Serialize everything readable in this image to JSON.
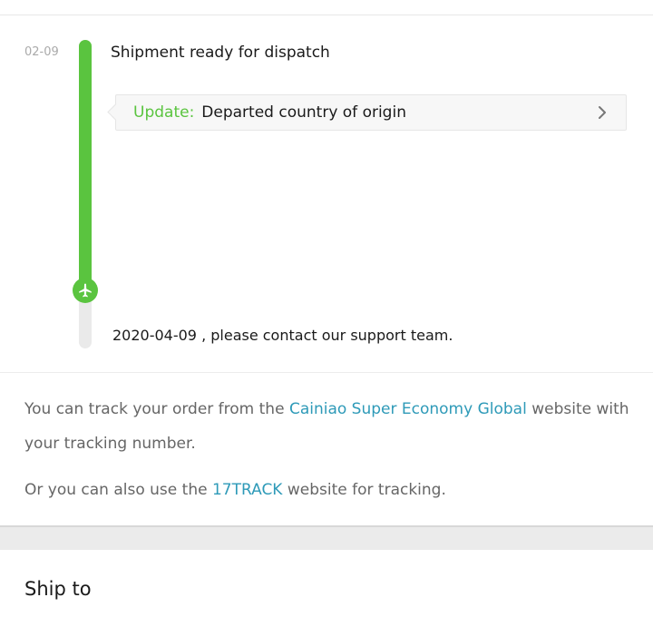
{
  "timeline": {
    "date": "02-09",
    "event_title": "Shipment ready for dispatch",
    "update_label": "Update:",
    "update_text": "Departed country of origin",
    "note": "2020-04-09 , please contact our support team."
  },
  "info": {
    "para1_prefix": "You can track your order from the ",
    "para1_link": "Cainiao Super Economy Global",
    "para1_suffix": " website with your tracking number.",
    "para2_prefix": "Or you can also use the ",
    "para2_link": "17TRACK",
    "para2_suffix": " website for tracking."
  },
  "ship_to": {
    "title": "Ship to"
  },
  "colors": {
    "accent_green": "#5ac43f",
    "link_blue": "#2e9ab8"
  },
  "icons": {
    "timeline_marker": "airplane-icon",
    "update_arrow": "chevron-right-icon"
  }
}
